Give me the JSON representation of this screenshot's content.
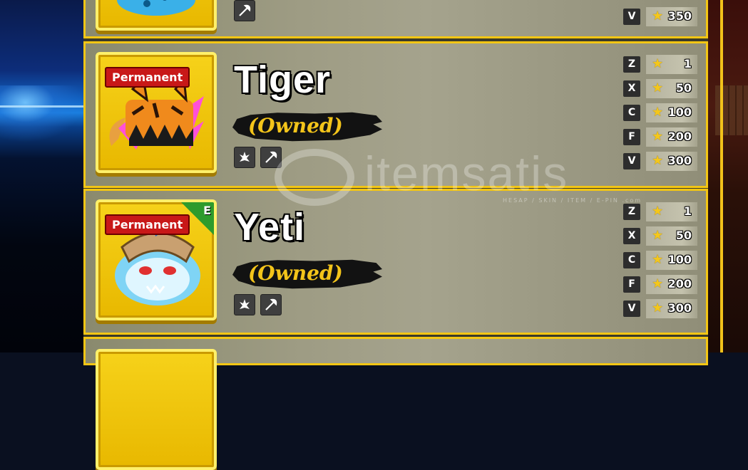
{
  "watermark": {
    "text": "itemsatis",
    "subtext": "HESAP / SKIN / ITEM / E-PIN .com"
  },
  "colors": {
    "panel_border": "#f3c614",
    "badge_red": "#c81818",
    "owned_gold": "#f3c41a",
    "star_gold": "#f4c71b",
    "rarity_green": "#2e9b2c"
  },
  "top_row": {
    "moves": [
      {
        "key": "V",
        "value": "350"
      }
    ],
    "skill_icons": [
      "sword-icon"
    ]
  },
  "fruits": [
    {
      "badge": "Permanent",
      "rarity_corner": "",
      "name": "Tiger",
      "status": "(Owned)",
      "skill_icons": [
        "fruit-icon",
        "sword-icon"
      ],
      "moves": [
        {
          "key": "Z",
          "value": "1"
        },
        {
          "key": "X",
          "value": "50"
        },
        {
          "key": "C",
          "value": "100"
        },
        {
          "key": "F",
          "value": "200"
        },
        {
          "key": "V",
          "value": "300"
        }
      ]
    },
    {
      "badge": "Permanent",
      "rarity_corner": "E",
      "name": "Yeti",
      "status": "(Owned)",
      "skill_icons": [
        "fruit-icon",
        "sword-icon"
      ],
      "moves": [
        {
          "key": "Z",
          "value": "1"
        },
        {
          "key": "X",
          "value": "50"
        },
        {
          "key": "C",
          "value": "100"
        },
        {
          "key": "F",
          "value": "200"
        },
        {
          "key": "V",
          "value": "300"
        }
      ]
    }
  ]
}
